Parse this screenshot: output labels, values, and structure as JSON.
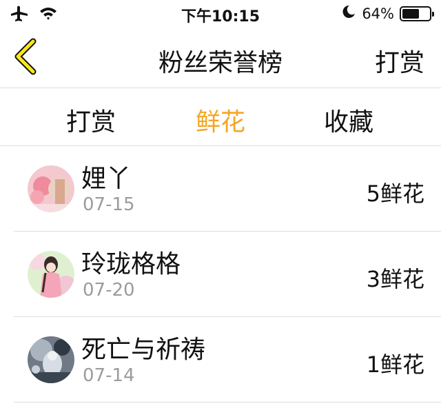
{
  "status_bar": {
    "time": "下午10:15",
    "battery_text": "64%",
    "battery_level": 0.64,
    "icons": [
      "airplane-icon",
      "wifi-icon",
      "moon-icon",
      "battery-icon"
    ]
  },
  "nav": {
    "back_icon": "chevron-left-icon",
    "title": "粉丝荣誉榜",
    "action_label": "打赏"
  },
  "tabs": [
    {
      "label": "打赏",
      "active": false
    },
    {
      "label": "鲜花",
      "active": true
    },
    {
      "label": "收藏",
      "active": false
    }
  ],
  "colors": {
    "accent": "#f5a623",
    "back_arrow": "#f8e71c",
    "secondary_text": "#9b9b9b",
    "divider": "#dddddd"
  },
  "fans": [
    {
      "name": "娌丫",
      "date": "07-15",
      "amount": "5鲜花"
    },
    {
      "name": "玲珑格格",
      "date": "07-20",
      "amount": "3鲜花"
    },
    {
      "name": "死亡与祈祷",
      "date": "07-14",
      "amount": "1鲜花"
    }
  ]
}
